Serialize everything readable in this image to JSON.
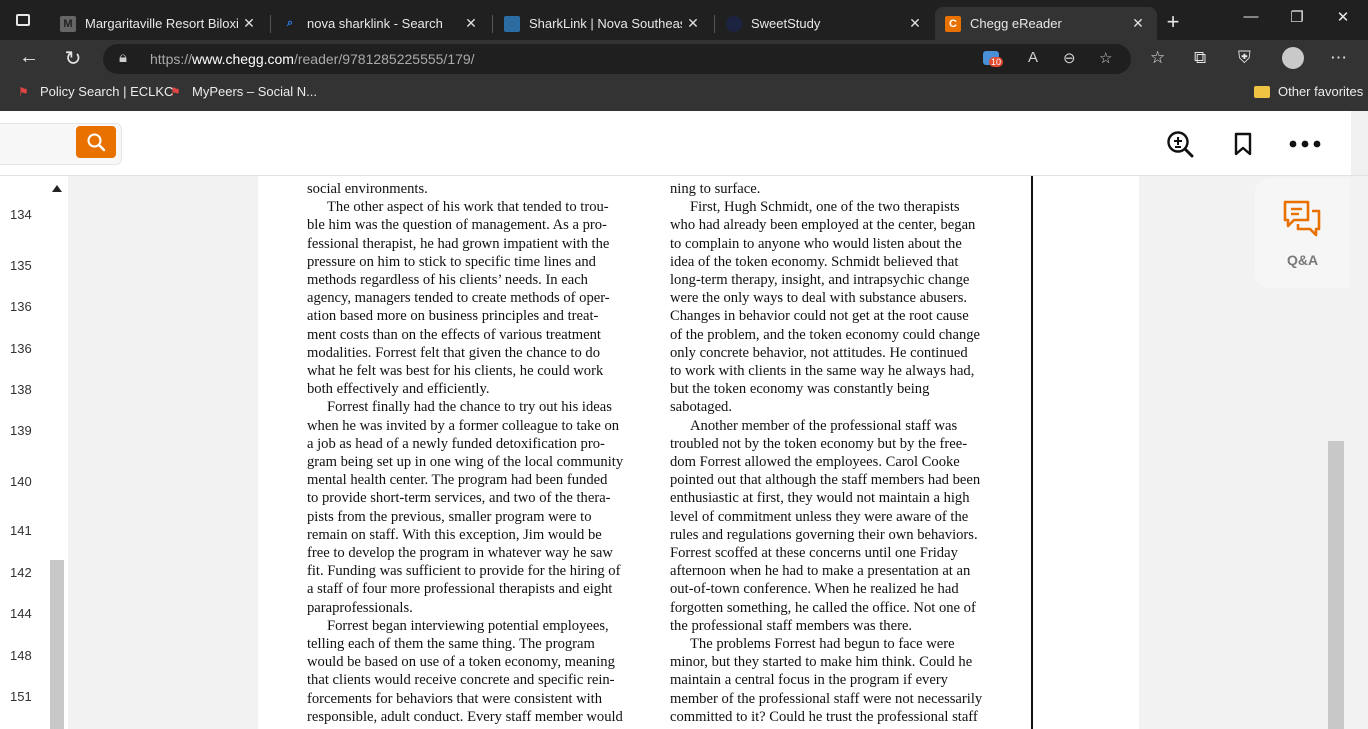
{
  "browser": {
    "tabs": [
      {
        "title": "Margaritaville Resort Biloxi - R",
        "favicon": "M"
      },
      {
        "title": "nova sharklink - Search",
        "favicon": "search-icon"
      },
      {
        "title": "SharkLink | Nova Southeaster",
        "favicon": "sharklink-logo"
      },
      {
        "title": "SweetStudy",
        "favicon": "sweetstudy-logo"
      },
      {
        "title": "Chegg eReader",
        "favicon": "C",
        "active": true
      }
    ],
    "url_prefix": "https://",
    "url_domain": "www.chegg.com",
    "url_path": "/reader/9781285225555/179/",
    "tracking_count": "10",
    "favorites": [
      {
        "label": "Policy Search | ECLKC"
      },
      {
        "label": "MyPeers – Social N..."
      }
    ],
    "other_favorites": "Other favorites"
  },
  "app": {
    "qa_label": "Q&A",
    "accent_color": "#e87100"
  },
  "page_numbers": [
    "134",
    "135",
    "136",
    "136",
    "138",
    "139",
    "140",
    "141",
    "142",
    "144",
    "148",
    "151"
  ],
  "reader": {
    "left_column": [
      {
        "text": "social environments.",
        "indent": false
      },
      {
        "text": "The other aspect of his work that tended to trou-",
        "indent": true
      },
      {
        "text": "ble him was the question of management. As a pro-",
        "indent": false
      },
      {
        "text": "fessional therapist, he had grown impatient with the",
        "indent": false
      },
      {
        "text": "pressure on him to stick to specific time lines and",
        "indent": false
      },
      {
        "text": "methods regardless of his clients’ needs. In each",
        "indent": false
      },
      {
        "text": "agency, managers tended to create methods of oper-",
        "indent": false
      },
      {
        "text": "ation based more on business principles and treat-",
        "indent": false
      },
      {
        "text": "ment costs than on the effects of various treatment",
        "indent": false
      },
      {
        "text": "modalities. Forrest felt that given the chance to do",
        "indent": false
      },
      {
        "text": "what he felt was best for his clients, he could work",
        "indent": false
      },
      {
        "text": "both effectively and efficiently.",
        "indent": false
      },
      {
        "text": "Forrest finally had the chance to try out his ideas",
        "indent": true
      },
      {
        "text": "when he was invited by a former colleague to take on",
        "indent": false
      },
      {
        "text": "a job as head of a newly funded detoxification pro-",
        "indent": false
      },
      {
        "text": "gram being set up in one wing of the local community",
        "indent": false
      },
      {
        "text": "mental health center. The program had been funded",
        "indent": false
      },
      {
        "text": "to provide short-term services, and two of the thera-",
        "indent": false
      },
      {
        "text": "pists from the previous, smaller program were to",
        "indent": false
      },
      {
        "text": "remain on staff. With this exception, Jim would be",
        "indent": false
      },
      {
        "text": "free to develop the program in whatever way he saw",
        "indent": false
      },
      {
        "text": "fit. Funding was sufficient to provide for the hiring of",
        "indent": false
      },
      {
        "text": "a staff of four more professional therapists and eight",
        "indent": false
      },
      {
        "text": "paraprofessionals.",
        "indent": false
      },
      {
        "text": "Forrest began interviewing potential employees,",
        "indent": true
      },
      {
        "text": "telling each of them the same thing. The program",
        "indent": false
      },
      {
        "text": "would be based on use of a token economy, meaning",
        "indent": false
      },
      {
        "text": "that clients would receive concrete and specific rein-",
        "indent": false
      },
      {
        "text": "forcements for behaviors that were consistent with",
        "indent": false
      },
      {
        "text": "responsible, adult conduct. Every staff member would",
        "indent": false
      }
    ],
    "right_column": [
      {
        "text": "ning to surface.",
        "indent": false
      },
      {
        "text": "First, Hugh Schmidt, one of the two therapists",
        "indent": true
      },
      {
        "text": "who had already been employed at the center, began",
        "indent": false
      },
      {
        "text": "to complain to anyone who would listen about the",
        "indent": false
      },
      {
        "text": "idea of the token economy. Schmidt believed that",
        "indent": false
      },
      {
        "text": "long-term therapy, insight, and intrapsychic change",
        "indent": false
      },
      {
        "text": "were the only ways to deal with substance abusers.",
        "indent": false
      },
      {
        "text": "Changes in behavior could not get at the root cause",
        "indent": false
      },
      {
        "text": "of the problem, and the token economy could change",
        "indent": false
      },
      {
        "text": "only concrete behavior, not attitudes. He continued",
        "indent": false
      },
      {
        "text": "to work with clients in the same way he always had,",
        "indent": false
      },
      {
        "text": "but the token economy was constantly being",
        "indent": false
      },
      {
        "text": "sabotaged.",
        "indent": false
      },
      {
        "text": "Another member of the professional staff was",
        "indent": true
      },
      {
        "text": "troubled not by the token economy but by the free-",
        "indent": false
      },
      {
        "text": "dom Forrest allowed the employees. Carol Cooke",
        "indent": false
      },
      {
        "text": "pointed out that although the staff members had been",
        "indent": false
      },
      {
        "text": "enthusiastic at first, they would not maintain a high",
        "indent": false
      },
      {
        "text": "level of commitment unless they were aware of the",
        "indent": false
      },
      {
        "text": "rules and regulations governing their own behaviors.",
        "indent": false
      },
      {
        "text": "Forrest scoffed at these concerns until one Friday",
        "indent": false
      },
      {
        "text": "afternoon when he had to make a presentation at an",
        "indent": false
      },
      {
        "text": "out-of-town conference. When he realized he had",
        "indent": false
      },
      {
        "text": "forgotten something, he called the office. Not one of",
        "indent": false
      },
      {
        "text": "the professional staff members was there.",
        "indent": false
      },
      {
        "text": "The problems Forrest had begun to face were",
        "indent": true
      },
      {
        "text": "minor, but they started to make him think. Could he",
        "indent": false
      },
      {
        "text": "maintain a central focus in the program if every",
        "indent": false
      },
      {
        "text": "member of the professional staff were not necessarily",
        "indent": false
      },
      {
        "text": "committed to it? Could he trust the professional staff",
        "indent": false
      }
    ]
  }
}
